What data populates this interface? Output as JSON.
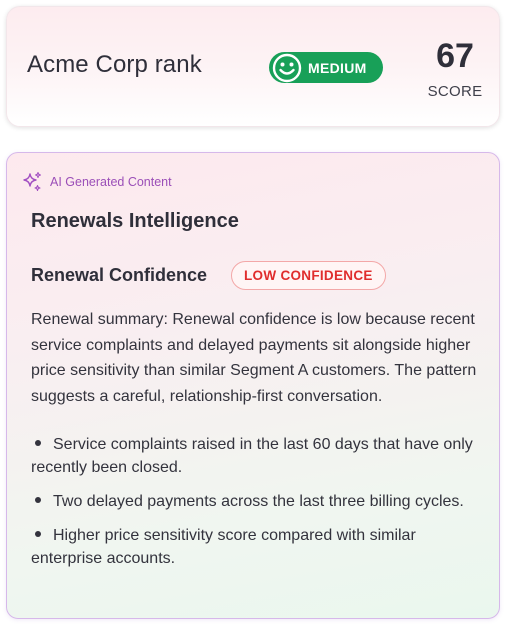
{
  "rank_card": {
    "title": "Acme Corp rank",
    "badge_label": "MEDIUM",
    "badge_icon": "smiley-face-icon",
    "badge_color": "#18a058",
    "score_value": "67",
    "score_label": "SCORE"
  },
  "ai_card": {
    "ai_label": "AI Generated Content",
    "ai_icon": "sparkle-icon",
    "section_title": "Renewals Intelligence",
    "renewal_title": "Renewal Confidence",
    "confidence_badge": "LOW CONFIDENCE",
    "confidence_color": "#e02d2d",
    "summary": "Renewal summary: Renewal confidence is low because recent service complaints and delayed payments sit alongside higher price sensitivity than similar Segment A customers. The pattern suggests a careful, relationship-first conversation.",
    "bullets": [
      "Service complaints raised in the last 60 days that have only recently been closed.",
      "Two delayed payments across the last three billing cycles.",
      "Higher price sensitivity score compared with similar enterprise accounts."
    ]
  }
}
